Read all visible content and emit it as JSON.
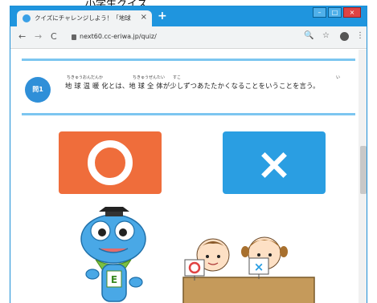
{
  "caption": "小学生クイズ",
  "browser": {
    "tab_title": "クイズにチャレンジしよう！「地球温",
    "tab_close": "×",
    "new_tab": "+",
    "url": "next60.cc-eriwa.jp/quiz/",
    "window_controls": {
      "minimize": "–",
      "maximize": "□",
      "close": "×"
    },
    "nav": {
      "back": "←",
      "forward": "→",
      "reload": "C"
    },
    "toolbar_icons": {
      "search": "🔍",
      "star": "☆",
      "menu": "⋮"
    }
  },
  "quiz": {
    "badge": "問1",
    "ruby": [
      "ちきゅうおんだんか",
      "ちきゅうぜんたい",
      "すこ",
      "い"
    ],
    "question": "地 球 温 暖 化とは、地 球 全 体が少しずつあたたかくなることをいうことを言う。"
  },
  "answers": {
    "true_label": "○",
    "false_label": "×"
  },
  "illustration": {
    "mascot_letter": "E",
    "card_left": "○",
    "card_right": "×"
  },
  "colors": {
    "chrome_blue": "#1f95de",
    "true_orange": "#ef6d3b",
    "false_blue": "#2a9ee2",
    "badge_blue": "#2f8fd8",
    "rule_blue": "#7cc6f0"
  }
}
